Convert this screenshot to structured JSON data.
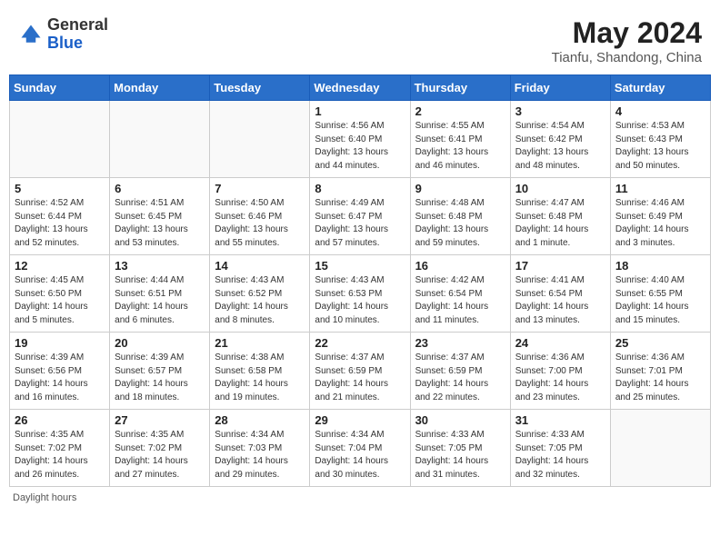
{
  "header": {
    "logo_general": "General",
    "logo_blue": "Blue",
    "month_title": "May 2024",
    "location": "Tianfu, Shandong, China"
  },
  "days_of_week": [
    "Sunday",
    "Monday",
    "Tuesday",
    "Wednesday",
    "Thursday",
    "Friday",
    "Saturday"
  ],
  "weeks": [
    [
      {
        "day": "",
        "info": ""
      },
      {
        "day": "",
        "info": ""
      },
      {
        "day": "",
        "info": ""
      },
      {
        "day": "1",
        "info": "Sunrise: 4:56 AM\nSunset: 6:40 PM\nDaylight: 13 hours\nand 44 minutes."
      },
      {
        "day": "2",
        "info": "Sunrise: 4:55 AM\nSunset: 6:41 PM\nDaylight: 13 hours\nand 46 minutes."
      },
      {
        "day": "3",
        "info": "Sunrise: 4:54 AM\nSunset: 6:42 PM\nDaylight: 13 hours\nand 48 minutes."
      },
      {
        "day": "4",
        "info": "Sunrise: 4:53 AM\nSunset: 6:43 PM\nDaylight: 13 hours\nand 50 minutes."
      }
    ],
    [
      {
        "day": "5",
        "info": "Sunrise: 4:52 AM\nSunset: 6:44 PM\nDaylight: 13 hours\nand 52 minutes."
      },
      {
        "day": "6",
        "info": "Sunrise: 4:51 AM\nSunset: 6:45 PM\nDaylight: 13 hours\nand 53 minutes."
      },
      {
        "day": "7",
        "info": "Sunrise: 4:50 AM\nSunset: 6:46 PM\nDaylight: 13 hours\nand 55 minutes."
      },
      {
        "day": "8",
        "info": "Sunrise: 4:49 AM\nSunset: 6:47 PM\nDaylight: 13 hours\nand 57 minutes."
      },
      {
        "day": "9",
        "info": "Sunrise: 4:48 AM\nSunset: 6:48 PM\nDaylight: 13 hours\nand 59 minutes."
      },
      {
        "day": "10",
        "info": "Sunrise: 4:47 AM\nSunset: 6:48 PM\nDaylight: 14 hours\nand 1 minute."
      },
      {
        "day": "11",
        "info": "Sunrise: 4:46 AM\nSunset: 6:49 PM\nDaylight: 14 hours\nand 3 minutes."
      }
    ],
    [
      {
        "day": "12",
        "info": "Sunrise: 4:45 AM\nSunset: 6:50 PM\nDaylight: 14 hours\nand 5 minutes."
      },
      {
        "day": "13",
        "info": "Sunrise: 4:44 AM\nSunset: 6:51 PM\nDaylight: 14 hours\nand 6 minutes."
      },
      {
        "day": "14",
        "info": "Sunrise: 4:43 AM\nSunset: 6:52 PM\nDaylight: 14 hours\nand 8 minutes."
      },
      {
        "day": "15",
        "info": "Sunrise: 4:43 AM\nSunset: 6:53 PM\nDaylight: 14 hours\nand 10 minutes."
      },
      {
        "day": "16",
        "info": "Sunrise: 4:42 AM\nSunset: 6:54 PM\nDaylight: 14 hours\nand 11 minutes."
      },
      {
        "day": "17",
        "info": "Sunrise: 4:41 AM\nSunset: 6:54 PM\nDaylight: 14 hours\nand 13 minutes."
      },
      {
        "day": "18",
        "info": "Sunrise: 4:40 AM\nSunset: 6:55 PM\nDaylight: 14 hours\nand 15 minutes."
      }
    ],
    [
      {
        "day": "19",
        "info": "Sunrise: 4:39 AM\nSunset: 6:56 PM\nDaylight: 14 hours\nand 16 minutes."
      },
      {
        "day": "20",
        "info": "Sunrise: 4:39 AM\nSunset: 6:57 PM\nDaylight: 14 hours\nand 18 minutes."
      },
      {
        "day": "21",
        "info": "Sunrise: 4:38 AM\nSunset: 6:58 PM\nDaylight: 14 hours\nand 19 minutes."
      },
      {
        "day": "22",
        "info": "Sunrise: 4:37 AM\nSunset: 6:59 PM\nDaylight: 14 hours\nand 21 minutes."
      },
      {
        "day": "23",
        "info": "Sunrise: 4:37 AM\nSunset: 6:59 PM\nDaylight: 14 hours\nand 22 minutes."
      },
      {
        "day": "24",
        "info": "Sunrise: 4:36 AM\nSunset: 7:00 PM\nDaylight: 14 hours\nand 23 minutes."
      },
      {
        "day": "25",
        "info": "Sunrise: 4:36 AM\nSunset: 7:01 PM\nDaylight: 14 hours\nand 25 minutes."
      }
    ],
    [
      {
        "day": "26",
        "info": "Sunrise: 4:35 AM\nSunset: 7:02 PM\nDaylight: 14 hours\nand 26 minutes."
      },
      {
        "day": "27",
        "info": "Sunrise: 4:35 AM\nSunset: 7:02 PM\nDaylight: 14 hours\nand 27 minutes."
      },
      {
        "day": "28",
        "info": "Sunrise: 4:34 AM\nSunset: 7:03 PM\nDaylight: 14 hours\nand 29 minutes."
      },
      {
        "day": "29",
        "info": "Sunrise: 4:34 AM\nSunset: 7:04 PM\nDaylight: 14 hours\nand 30 minutes."
      },
      {
        "day": "30",
        "info": "Sunrise: 4:33 AM\nSunset: 7:05 PM\nDaylight: 14 hours\nand 31 minutes."
      },
      {
        "day": "31",
        "info": "Sunrise: 4:33 AM\nSunset: 7:05 PM\nDaylight: 14 hours\nand 32 minutes."
      },
      {
        "day": "",
        "info": ""
      }
    ]
  ],
  "footer": {
    "note": "Daylight hours"
  }
}
